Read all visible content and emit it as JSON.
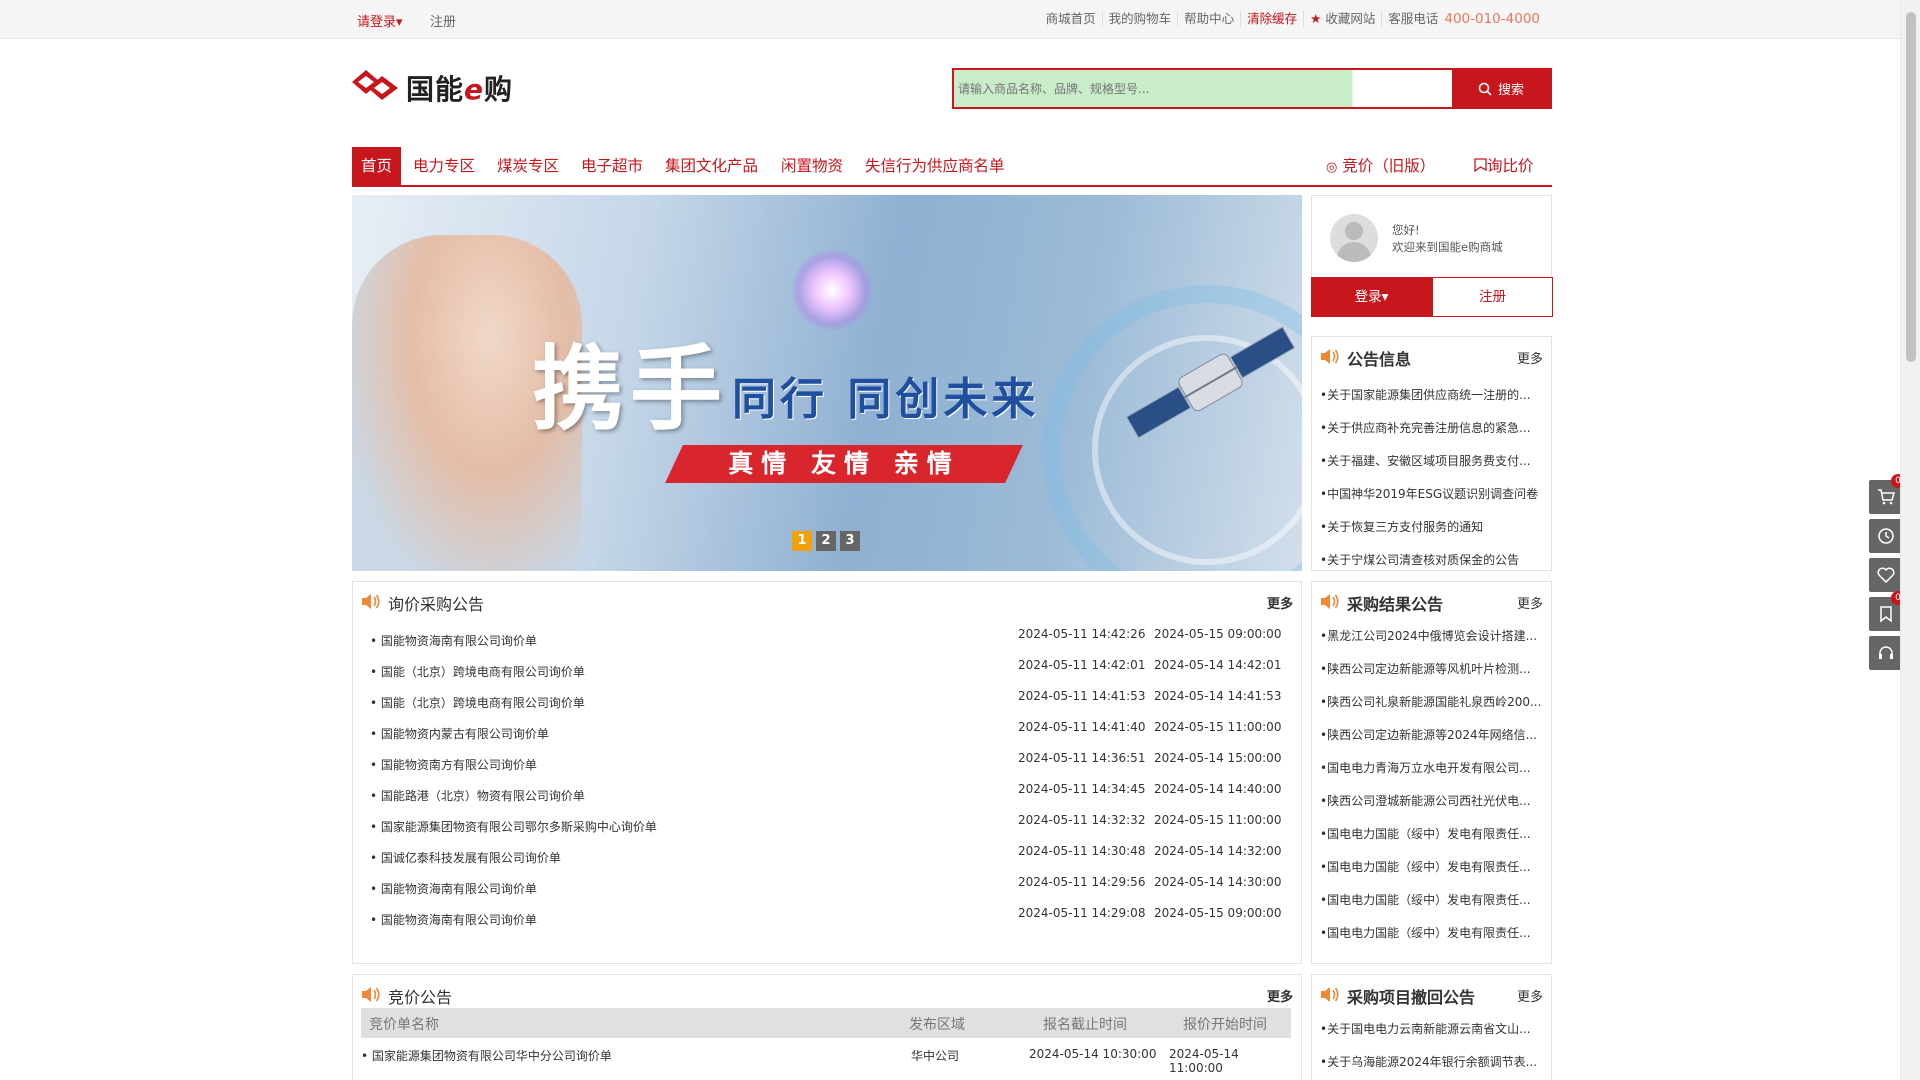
{
  "topbar": {
    "login": "请登录▾",
    "register": "注册",
    "links": [
      "商城首页",
      "我的购物车",
      "帮助中心",
      "清除缓存",
      "收藏网站"
    ],
    "phone_label": "客服电话",
    "phone": "400-010-4000"
  },
  "logo": {
    "text_pre": "国能",
    "text_e": "e",
    "text_post": "购"
  },
  "search": {
    "placeholder": "请输入商品名称、品牌、规格型号...",
    "button": "搜索"
  },
  "nav": {
    "items": [
      "首页",
      "电力专区",
      "煤炭专区",
      "电子超市",
      "集团文化产品",
      "闲置物资",
      "失信行为供应商名单"
    ],
    "right_bid": "竞价（旧版）",
    "right_compare": "询比价"
  },
  "banner": {
    "big_text": "携手",
    "sub_text": "同行 同创未来",
    "ribbon_text": "真情 友情 亲情",
    "dots": [
      "1",
      "2",
      "3"
    ]
  },
  "user": {
    "greeting_line1": "您好!",
    "greeting_line2": "欢迎来到国能e购商城",
    "login_btn": "登录▾",
    "register_btn": "注册"
  },
  "notice": {
    "title": "公告信息",
    "more": "更多",
    "items": [
      "•关于国家能源集团供应商统一注册的...",
      "•关于供应商补充完善注册信息的紧急...",
      "•关于福建、安徽区域项目服务费支付...",
      "•中国神华2019年ESG议题识别调查问卷",
      "•关于恢复三方支付服务的通知",
      "•关于宁煤公司清查核对质保金的公告"
    ]
  },
  "result": {
    "title": "采购结果公告",
    "more": "更多",
    "items": [
      "•黑龙江公司2024中俄博览会设计搭建...",
      "•陕西公司定边新能源等风机叶片检测...",
      "•陕西公司礼泉新能源国能礼泉西岭200...",
      "•陕西公司定边新能源等2024年网络信...",
      "•国电电力青海万立水电开发有限公司...",
      "•陕西公司澄城新能源公司西社光伏电...",
      "•国电电力国能（绥中）发电有限责任...",
      "•国电电力国能（绥中）发电有限责任...",
      "•国电电力国能（绥中）发电有限责任...",
      "•国电电力国能（绥中）发电有限责任..."
    ]
  },
  "withdraw": {
    "title": "采购项目撤回公告",
    "more": "更多",
    "items": [
      "•关于国电电力云南新能源云南省文山...",
      "•关于乌海能源2024年银行余额调节表..."
    ]
  },
  "inquiry": {
    "title": "询价采购公告",
    "more": "更多",
    "rows": [
      {
        "name": "• 国能物资海南有限公司询价单",
        "t1": "2024-05-11 14:42:26",
        "t2": "2024-05-15 09:00:00"
      },
      {
        "name": "• 国能（北京）跨境电商有限公司询价单",
        "t1": "2024-05-11 14:42:01",
        "t2": "2024-05-14 14:42:01"
      },
      {
        "name": "• 国能（北京）跨境电商有限公司询价单",
        "t1": "2024-05-11 14:41:53",
        "t2": "2024-05-14 14:41:53"
      },
      {
        "name": "• 国能物资内蒙古有限公司询价单",
        "t1": "2024-05-11 14:41:40",
        "t2": "2024-05-15 11:00:00"
      },
      {
        "name": "• 国能物资南方有限公司询价单",
        "t1": "2024-05-11 14:36:51",
        "t2": "2024-05-14 15:00:00"
      },
      {
        "name": "• 国能路港（北京）物资有限公司询价单",
        "t1": "2024-05-11 14:34:45",
        "t2": "2024-05-14 14:40:00"
      },
      {
        "name": "• 国家能源集团物资有限公司鄂尔多斯采购中心询价单",
        "t1": "2024-05-11 14:32:32",
        "t2": "2024-05-15 11:00:00"
      },
      {
        "name": "• 国诚亿泰科技发展有限公司询价单",
        "t1": "2024-05-11 14:30:48",
        "t2": "2024-05-14 14:32:00"
      },
      {
        "name": "• 国能物资海南有限公司询价单",
        "t1": "2024-05-11 14:29:56",
        "t2": "2024-05-14 14:30:00"
      },
      {
        "name": "• 国能物资海南有限公司询价单",
        "t1": "2024-05-11 14:29:08",
        "t2": "2024-05-15 09:00:00"
      }
    ]
  },
  "bid": {
    "title": "竞价公告",
    "more": "更多",
    "headers": [
      "竞价单名称",
      "发布区域",
      "报名截止时间",
      "报价开始时间"
    ],
    "rows": [
      {
        "name": "• 国家能源集团物资有限公司华中分公司询价单",
        "region": "华中公司",
        "deadline": "2024-05-14 10:30:00",
        "start": "2024-05-14 11:00:00"
      }
    ]
  },
  "float_bar": {
    "cart_count": "0",
    "fav_count": "0"
  },
  "colors": {
    "brand": "#c8161d",
    "phone": "#e8785b",
    "speaker": "#f0883a"
  }
}
